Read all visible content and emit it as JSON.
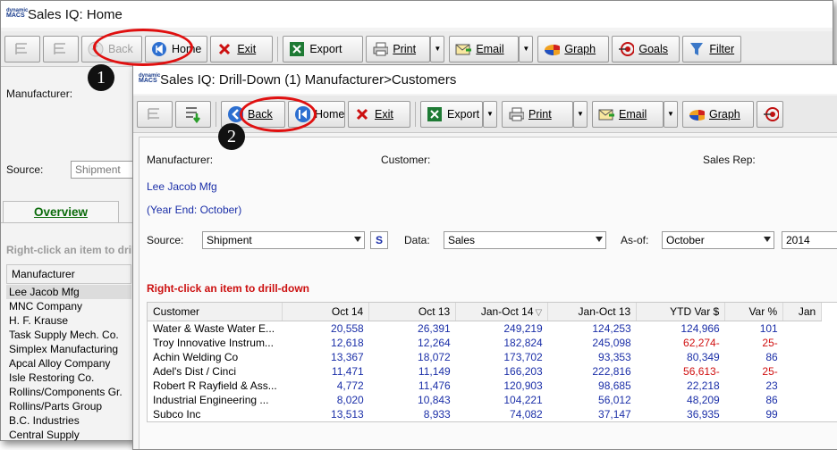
{
  "home": {
    "title": "Sales IQ: Home",
    "toolbar": {
      "back": "Back",
      "home": "Home",
      "exit": "Exit",
      "export": "Export",
      "print": "Print",
      "email": "Email",
      "graph": "Graph",
      "goals": "Goals",
      "filter": "Filter"
    },
    "manufacturer_label": "Manufacturer:",
    "source_label": "Source:",
    "source_value": "Shipment",
    "tab_overview": "Overview",
    "hint": "Right-click an item to dril",
    "list_header": "Manufacturer",
    "list_items": [
      "Lee Jacob Mfg",
      "MNC Company",
      "H. F. Krause",
      "Task Supply Mech. Co.",
      "Simplex Manufacturing",
      "Apcal Alloy Company",
      "Isle Restoring Co.",
      "Rollins/Components Gr.",
      "Rollins/Parts Group",
      "B.C. Industries",
      "Central Supply"
    ]
  },
  "drill": {
    "title": "Sales IQ: Drill-Down (1) Manufacturer>Customers",
    "toolbar": {
      "back": "Back",
      "home": "Home",
      "exit": "Exit",
      "export": "Export",
      "print": "Print",
      "email": "Email",
      "graph": "Graph"
    },
    "manufacturer_label": "Manufacturer:",
    "customer_label": "Customer:",
    "salesrep_label": "Sales Rep:",
    "manufacturer_value": "Lee Jacob Mfg",
    "year_end": "(Year End: October)",
    "source_label": "Source:",
    "source_value": "Shipment",
    "s_button": "S",
    "data_label": "Data:",
    "data_value": "Sales",
    "asof_label": "As-of:",
    "asof_month": "October",
    "asof_year": "2014",
    "hint": "Right-click an item to drill-down",
    "columns": [
      "Customer",
      "Oct 14",
      "Oct 13",
      "Jan-Oct 14",
      "Jan-Oct 13",
      "YTD Var $",
      "Var %",
      "Jan"
    ],
    "rows": [
      {
        "customer": "Water & Waste Water E...",
        "oct14": "20,558",
        "oct13": "26,391",
        "ytd14": "249,219",
        "ytd13": "124,253",
        "var": "124,966",
        "pct": "101",
        "neg": false
      },
      {
        "customer": "Troy Innovative Instrum...",
        "oct14": "12,618",
        "oct13": "12,264",
        "ytd14": "182,824",
        "ytd13": "245,098",
        "var": "62,274-",
        "pct": "25-",
        "neg": true
      },
      {
        "customer": "Achin Welding Co",
        "oct14": "13,367",
        "oct13": "18,072",
        "ytd14": "173,702",
        "ytd13": "93,353",
        "var": "80,349",
        "pct": "86",
        "neg": false
      },
      {
        "customer": "Adel's Dist / Cinci",
        "oct14": "11,471",
        "oct13": "11,149",
        "ytd14": "166,203",
        "ytd13": "222,816",
        "var": "56,613-",
        "pct": "25-",
        "neg": true
      },
      {
        "customer": "Robert R Rayfield & Ass...",
        "oct14": "4,772",
        "oct13": "11,476",
        "ytd14": "120,903",
        "ytd13": "98,685",
        "var": "22,218",
        "pct": "23",
        "neg": false
      },
      {
        "customer": "Industrial Engineering ...",
        "oct14": "8,020",
        "oct13": "10,843",
        "ytd14": "104,221",
        "ytd13": "56,012",
        "var": "48,209",
        "pct": "86",
        "neg": false
      },
      {
        "customer": "Subco Inc",
        "oct14": "13,513",
        "oct13": "8,933",
        "ytd14": "74,082",
        "ytd13": "37,147",
        "var": "36,935",
        "pct": "99",
        "neg": false
      }
    ]
  },
  "callouts": {
    "one": "1",
    "two": "2"
  },
  "colors": {
    "accent_red": "#e01010",
    "value_blue": "#1b2fa8",
    "overview_green": "#0a6b0a"
  }
}
